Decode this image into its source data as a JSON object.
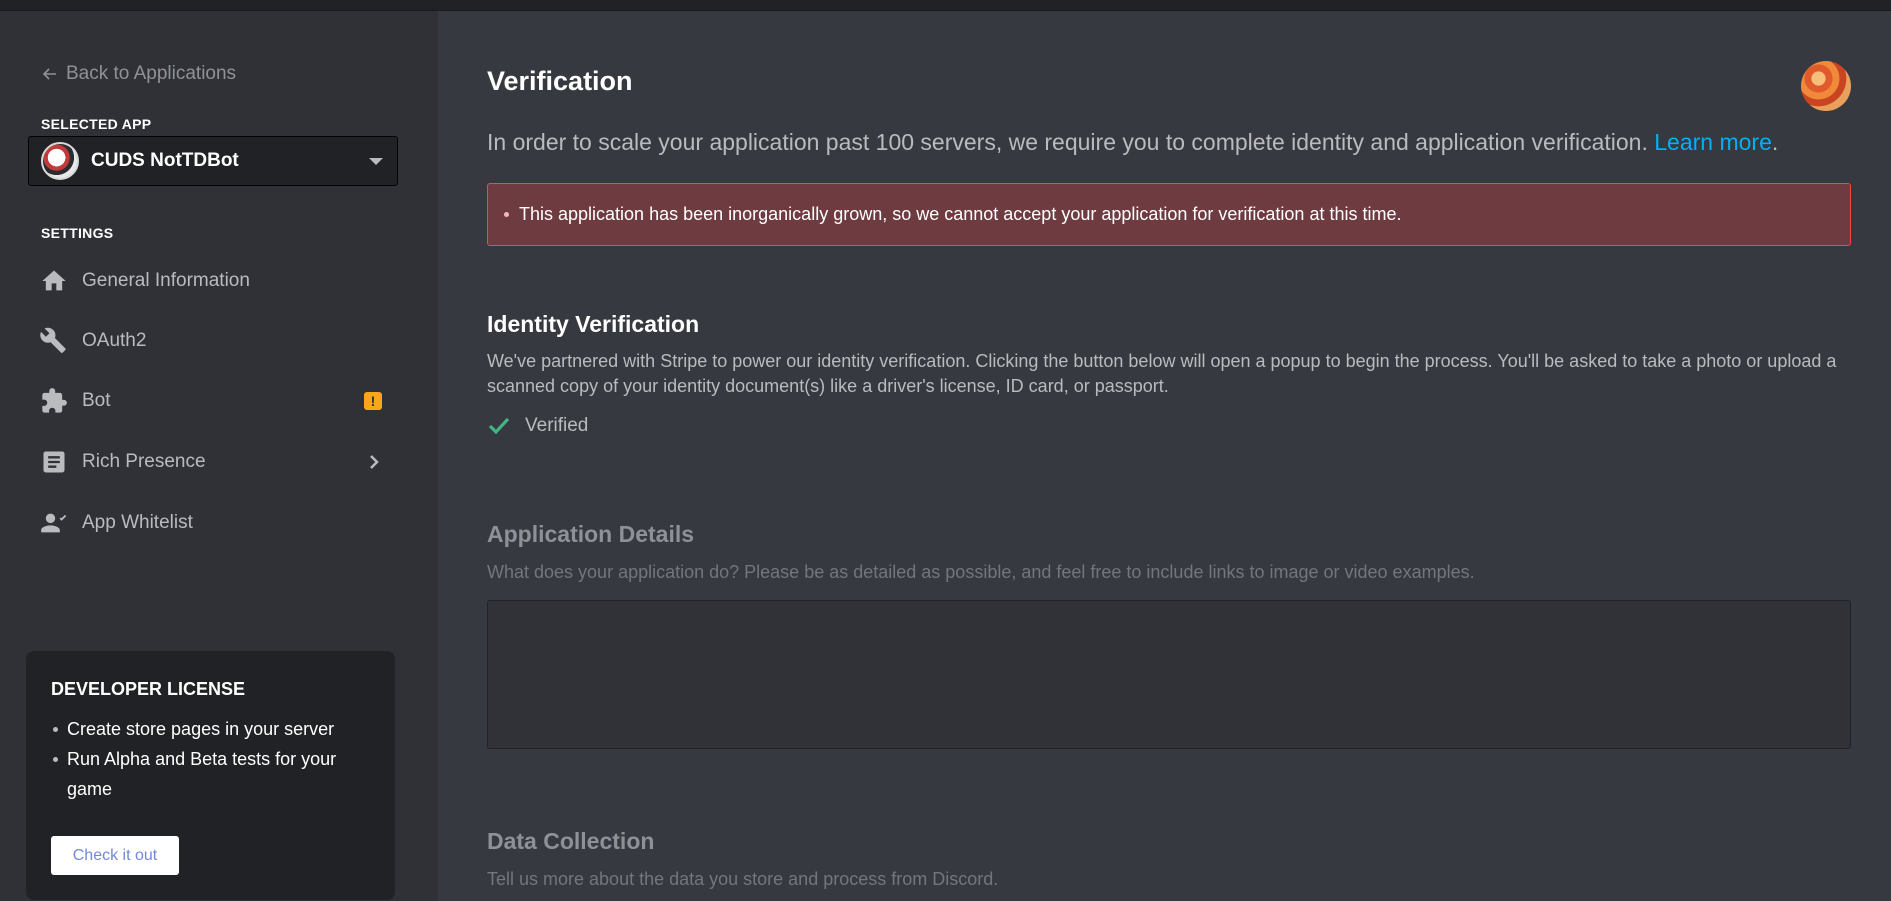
{
  "sidebar": {
    "back_label": "Back to Applications",
    "selected_app_label": "SELECTED APP",
    "app_name": "CUDS NotTDBot",
    "settings_label": "SETTINGS",
    "items": [
      {
        "label": "General Information",
        "icon": "home-icon"
      },
      {
        "label": "OAuth2",
        "icon": "wrench-icon"
      },
      {
        "label": "Bot",
        "icon": "puzzle-icon",
        "badge": "!"
      },
      {
        "label": "Rich Presence",
        "icon": "document-icon"
      },
      {
        "label": "App Whitelist",
        "icon": "user-list-icon"
      }
    ],
    "license": {
      "title": "DEVELOPER LICENSE",
      "bullets": [
        "Create store pages in your server",
        "Run Alpha and Beta tests for your game"
      ],
      "button": "Check it out"
    }
  },
  "main": {
    "title": "Verification",
    "intro": "In order to scale your application past 100 servers, we require you to complete identity and application verification.",
    "learn_more": "Learn more",
    "intro_end": ".",
    "alert": "This application has been inorganically grown, so we cannot accept your application for verification at this time.",
    "identity": {
      "heading": "Identity Verification",
      "description": "We've partnered with Stripe to power our identity verification. Clicking the button below will open a popup to begin the process. You'll be asked to take a photo or upload a scanned copy of your identity document(s) like a driver's license, ID card, or passport.",
      "status": "Verified"
    },
    "app_details": {
      "heading": "Application Details",
      "description": "What does your application do? Please be as detailed as possible, and feel free to include links to image or video examples.",
      "value": ""
    },
    "data_collection": {
      "heading": "Data Collection",
      "description": "Tell us more about the data you store and process from Discord."
    }
  },
  "colors": {
    "background": "#36393f",
    "sidebar": "#2f3136",
    "link": "#00b0f4",
    "alert_bg": "#6e3b41",
    "alert_border": "#f04747",
    "success": "#43b581",
    "warning": "#faa61a"
  }
}
